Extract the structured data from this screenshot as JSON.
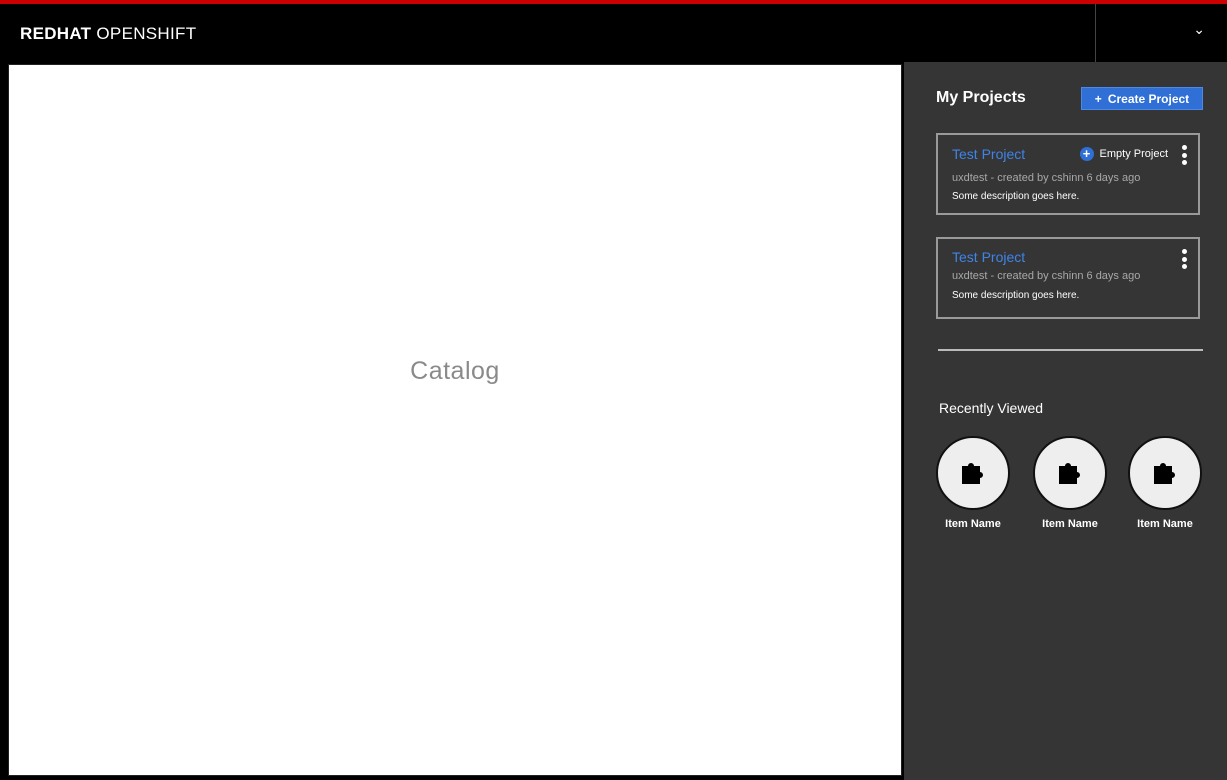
{
  "header": {
    "brand_bold": "REDHAT",
    "brand_light": "OPENSHIFT",
    "user_menu_icon": "chevron-down-icon"
  },
  "main": {
    "catalog_label": "Catalog"
  },
  "sidebar": {
    "title": "My Projects",
    "create_button": {
      "icon": "+",
      "label": "Create Project"
    },
    "projects": [
      {
        "name": "Test Project",
        "meta": "uxdtest - created by cshinn 6 days ago",
        "description": "Some description goes here.",
        "badge": "Empty Project"
      },
      {
        "name": "Test Project",
        "meta": "uxdtest - created by cshinn 6 days ago",
        "description": "Some description goes here."
      }
    ],
    "recently_viewed": {
      "title": "Recently Viewed",
      "items": [
        {
          "name": "Item Name",
          "icon": "puzzle-icon"
        },
        {
          "name": "Item Name",
          "icon": "puzzle-icon"
        },
        {
          "name": "Item Name",
          "icon": "puzzle-icon"
        }
      ]
    }
  },
  "colors": {
    "accent_red": "#cc0000",
    "primary_blue": "#2f6fd6",
    "link_blue": "#3f84e8",
    "sidebar_bg": "#353535"
  }
}
